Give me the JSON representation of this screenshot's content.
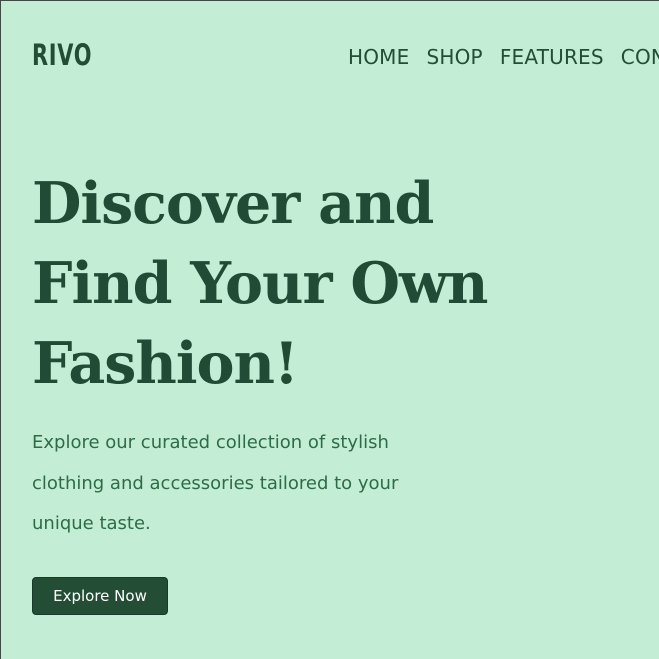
{
  "brand": {
    "logo": "RIVO"
  },
  "nav": {
    "items": [
      {
        "label": "HOME"
      },
      {
        "label": "SHOP"
      },
      {
        "label": "FEATURES"
      },
      {
        "label": "CONTACT"
      }
    ]
  },
  "hero": {
    "title": "Discover and Find Your Own Fashion!",
    "description": "Explore our curated collection of stylish clothing and accessories tailored to your unique taste.",
    "cta_label": "Explore Now"
  },
  "colors": {
    "background": "#c3eed5",
    "primary": "#234d34",
    "text_secondary": "#2e6b47",
    "button_text": "#ffffff"
  }
}
